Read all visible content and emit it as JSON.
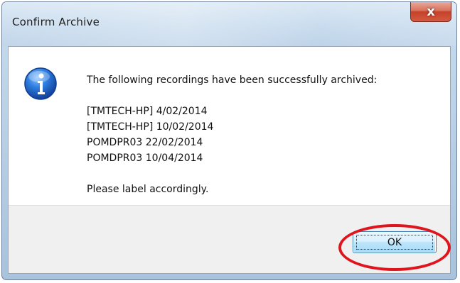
{
  "window": {
    "title": "Confirm Archive",
    "close_label": "x"
  },
  "dialog": {
    "icon": "info-icon",
    "heading": "The following recordings have been successfully archived:",
    "recordings": [
      "[TMTECH-HP] 4/02/2014",
      "[TMTECH-HP] 10/02/2014",
      "POMDPR03 22/02/2014",
      "POMDPR03 10/04/2014"
    ],
    "note": "Please label accordingly."
  },
  "buttons": {
    "ok_label": "OK"
  },
  "colors": {
    "annotation": "#e0141d",
    "titlebar": "#c3d8ec",
    "footer": "#f0f0f0",
    "info_icon": "#1f63c6"
  }
}
